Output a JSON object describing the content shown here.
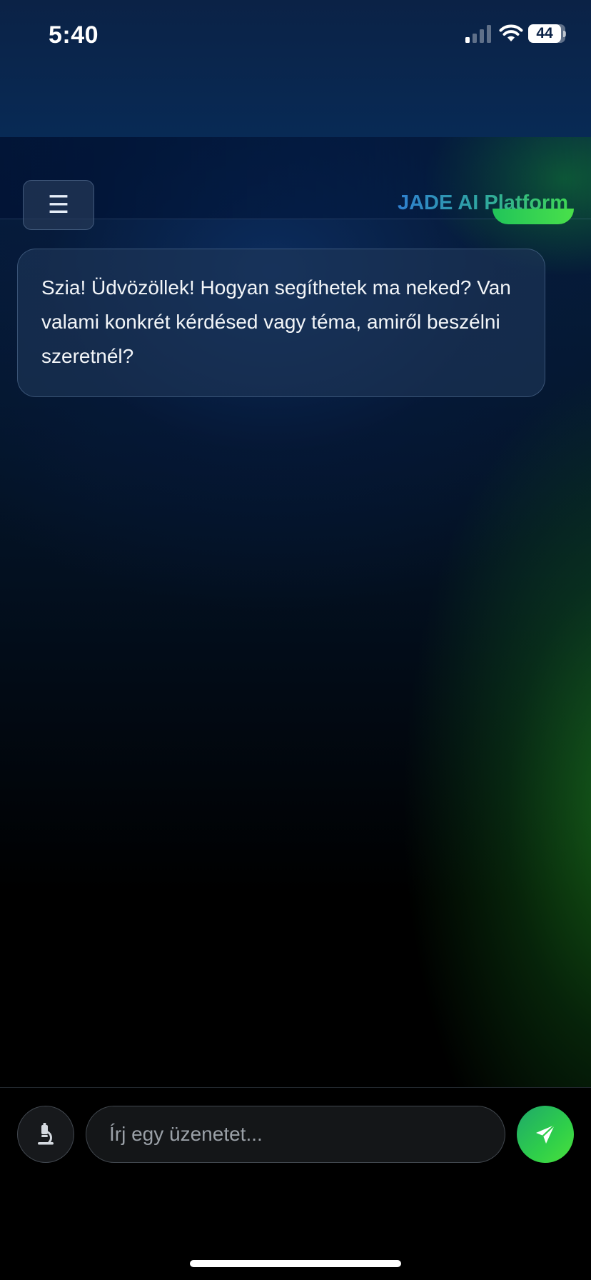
{
  "status_bar": {
    "time": "5:40",
    "battery": "44"
  },
  "header": {
    "menu_icon": "☰",
    "title": "JADE AI Platform"
  },
  "messages": [
    {
      "role": "assistant",
      "text": "Szia! Üdvözöllek! Hogyan segíthetek ma neked? Van valami konkrét kérdésed vagy téma, amiről beszélni szeretnél?"
    }
  ],
  "composer": {
    "placeholder": "Írj egy üzenetet...",
    "value": ""
  },
  "icons": {
    "menu": "hamburger-menu-icon",
    "microscope": "microscope-icon",
    "send": "send-plane-icon"
  },
  "colors": {
    "brand_blue": "#2f7fcf",
    "brand_green": "#3ed655",
    "send_gradient_start": "#1ea86a",
    "send_gradient_end": "#4be03c"
  }
}
